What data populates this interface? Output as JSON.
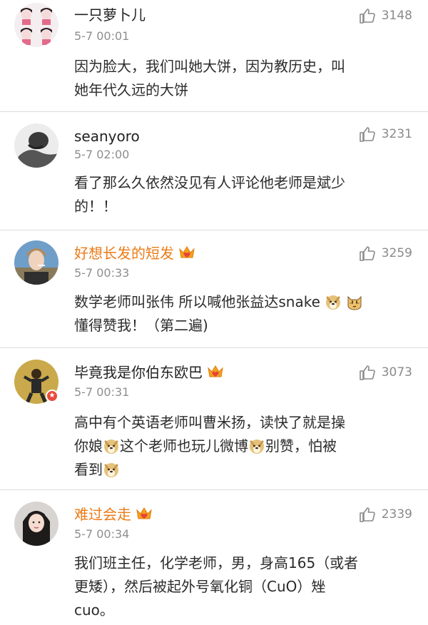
{
  "comments": [
    {
      "name": "一只萝卜儿",
      "time": "5-7 00:01",
      "likes": "3148",
      "lines": [
        "因为脸大，我们叫她大饼，因为教历史，叫",
        "她年代久远的大饼"
      ]
    },
    {
      "name": "seanyoro",
      "time": "5-7 02:00",
      "likes": "3231",
      "lines": [
        "看了那么久依然没见有人评论他老师是斌少",
        "的！！"
      ]
    },
    {
      "name": "好想长发的短发",
      "time": "5-7 00:33",
      "likes": "3259",
      "line1": "数学老师叫张伟 所以喊他张益达snake",
      "line2": "懂得赞我！（第二遍)"
    },
    {
      "name": "毕竟我是你伯东欧巴",
      "time": "5-7 00:31",
      "likes": "3073",
      "line1": "高中有个英语老师叫曹米扬，读快了就是操",
      "line2a": "你娘",
      "line2b": "这个老师也玩儿微博",
      "line2c": "别赞，怕被",
      "line3": "看到"
    },
    {
      "name": "难过会走",
      "time": "5-7 00:34",
      "likes": "2339",
      "lines": [
        "我们班主任，化学老师，男，身高165（或者",
        "更矮），然后被起外号氧化铜（CuO）矬",
        "cuo。"
      ]
    }
  ],
  "icons": {
    "like": "thumbs-up-icon",
    "vip": "crown-icon",
    "emoji_doge": "doge-emoji",
    "emoji_cat": "cat-emoji",
    "verified": "star-badge-icon"
  },
  "colors": {
    "vip_name": "#eb7b17",
    "normal_name": "#222222",
    "time": "#8e8e8e",
    "divider": "#dcdcdc",
    "like": "#8a8a8a"
  }
}
